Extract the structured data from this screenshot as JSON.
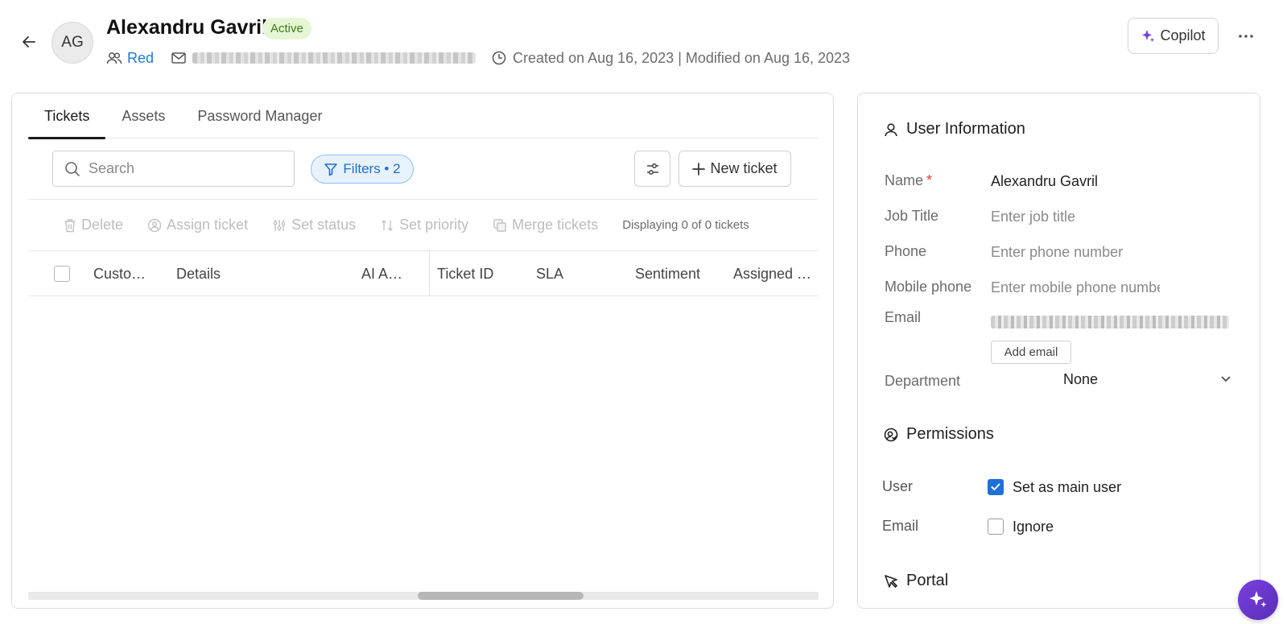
{
  "header": {
    "avatar_initials": "AG",
    "user_name": "Alexandru Gavril",
    "status": "Active",
    "group": "Red",
    "dates": "Created on Aug 16, 2023 | Modified on Aug 16, 2023",
    "copilot_label": "Copilot"
  },
  "tabs": [
    {
      "label": "Tickets",
      "active": true
    },
    {
      "label": "Assets",
      "active": false
    },
    {
      "label": "Password Manager",
      "active": false
    }
  ],
  "toolbar": {
    "search_placeholder": "Search",
    "filters_label": "Filters • 2",
    "new_ticket_label": "New ticket"
  },
  "actions": {
    "delete": "Delete",
    "assign": "Assign ticket",
    "set_status": "Set status",
    "set_priority": "Set priority",
    "merge": "Merge tickets",
    "displaying": "Displaying 0 of 0 tickets"
  },
  "table": {
    "columns": [
      "Custo…",
      "Details",
      "AI A…",
      "Ticket ID",
      "SLA",
      "Sentiment",
      "Assigned …"
    ]
  },
  "user_info": {
    "title": "User Information",
    "name_label": "Name",
    "name_value": "Alexandru Gavril",
    "job_title_label": "Job Title",
    "job_title_placeholder": "Enter job title",
    "phone_label": "Phone",
    "phone_placeholder": "Enter phone number",
    "mobile_label": "Mobile phone",
    "mobile_placeholder": "Enter mobile phone number",
    "email_label": "Email",
    "add_email_label": "Add email",
    "department_label": "Department",
    "department_value": "None"
  },
  "permissions": {
    "title": "Permissions",
    "user_label": "User",
    "user_option": "Set as main user",
    "user_checked": true,
    "email_label": "Email",
    "email_option": "Ignore",
    "email_checked": false
  },
  "portal": {
    "title": "Portal"
  },
  "colors": {
    "accent": "#1e6fcf",
    "status_bg": "#e6f6d5",
    "status_text": "#3f7a1e",
    "fab": "#6a35d0"
  },
  "icons": [
    "arrow-left-icon",
    "users-icon",
    "mail-icon",
    "clock-icon",
    "sparkle-icon",
    "more-horizontal-icon",
    "search-icon",
    "filter-icon",
    "sliders-icon",
    "plus-icon",
    "trash-icon",
    "assign-icon",
    "status-icon",
    "sort-icon",
    "merge-icon",
    "user-icon",
    "permission-icon",
    "cursor-icon",
    "chevron-down-icon",
    "check-icon"
  ]
}
